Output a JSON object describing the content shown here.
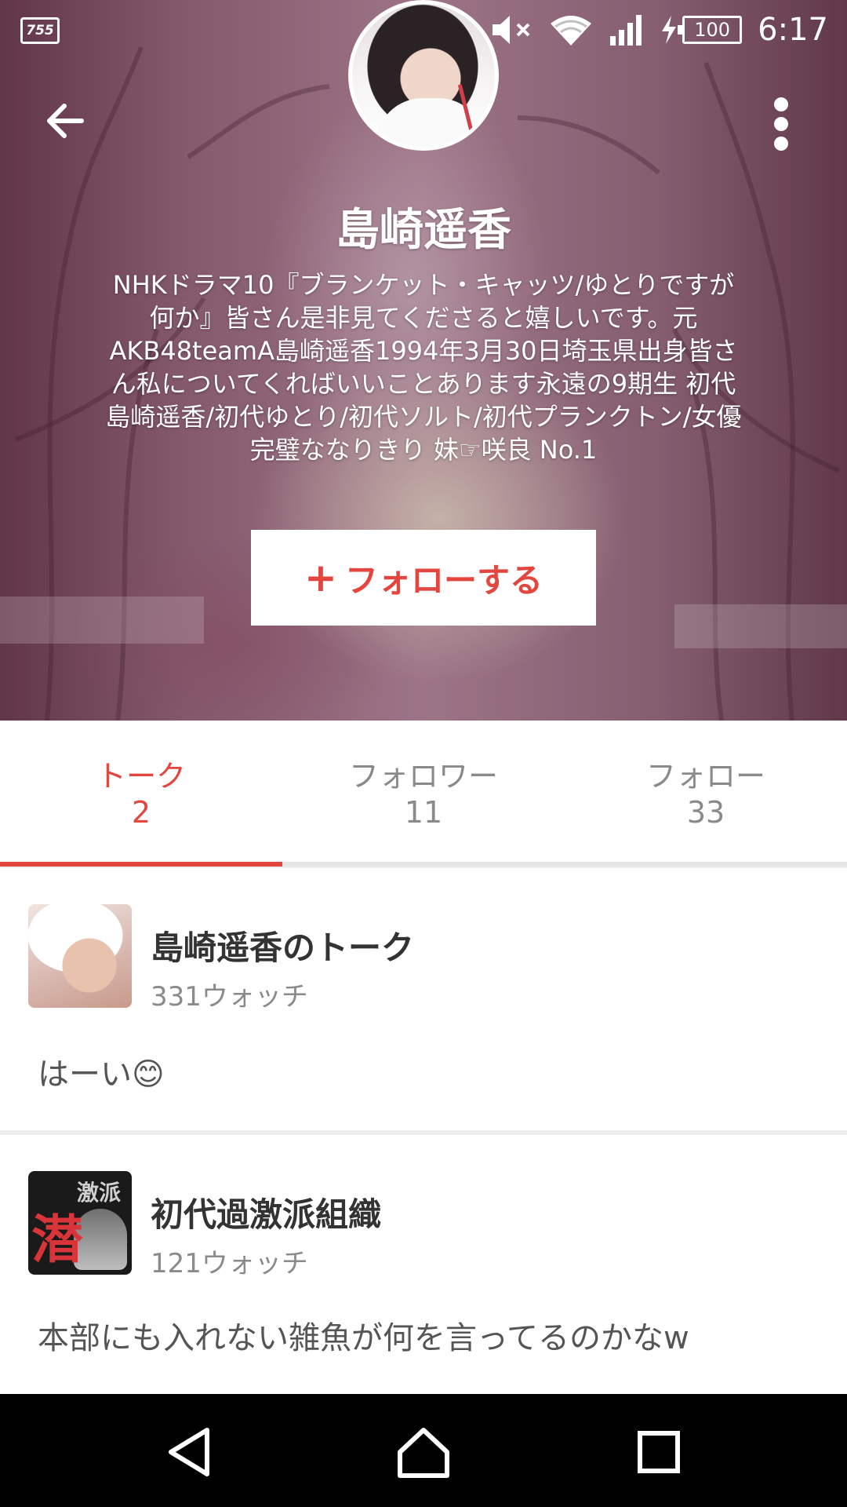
{
  "status_bar": {
    "app_icon_text": "755",
    "battery": "100",
    "time": "6:17"
  },
  "profile": {
    "name": "島崎遥香",
    "bio": "NHKドラマ10『ブランケット・キャッツ/ゆとりですが何か』皆さん是非見てくださると嬉しいです。元AKB48teamA島崎遥香1994年3月30日埼玉県出身皆さん私についてくればいいことあります永遠の9期生 初代島崎遥香/初代ゆとり/初代ソルト/初代プランクトン/女優完璧ななりきり 妹☞咲良 No.1",
    "follow_label": "フォローする"
  },
  "tabs": [
    {
      "label": "トーク",
      "count": "2",
      "active": true
    },
    {
      "label": "フォロワー",
      "count": "11",
      "active": false
    },
    {
      "label": "フォロー",
      "count": "33",
      "active": false
    }
  ],
  "talks": [
    {
      "title": "島崎遥香のトーク",
      "watch": "331ウォッチ",
      "message": "はーい😊"
    },
    {
      "title": "初代過激派組織",
      "watch": "121ウォッチ",
      "message": "本部にも入れない雑魚が何を言ってるのかなw",
      "thumb_big": "潜",
      "thumb_small": "激派"
    }
  ],
  "colors": {
    "accent": "#e2463f"
  },
  "icons": {
    "back": "arrow-left-icon",
    "more": "more-vertical-icon",
    "bluetooth": "bluetooth-icon",
    "mute": "volume-mute-icon",
    "wifi": "wifi-icon",
    "signal": "signal-icon",
    "charging": "charging-bolt-icon",
    "nav_back": "nav-back-icon",
    "nav_home": "nav-home-icon",
    "nav_recents": "nav-recents-icon"
  }
}
